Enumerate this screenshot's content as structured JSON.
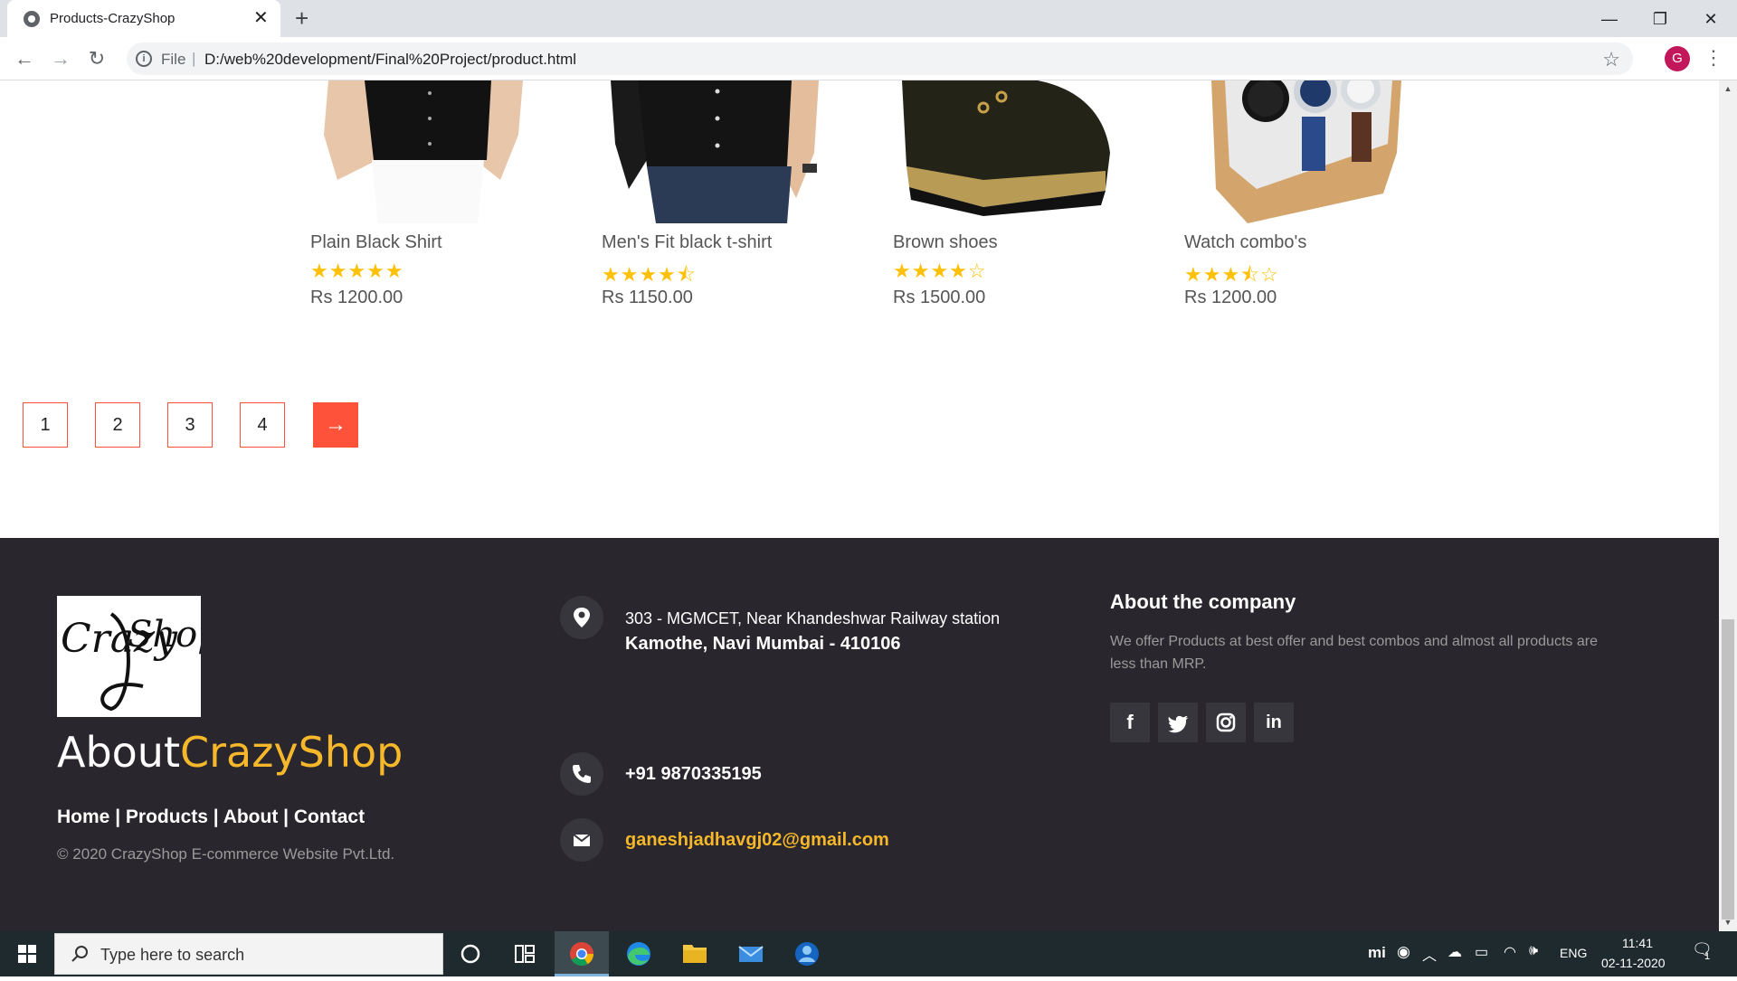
{
  "browser": {
    "tab_title": "Products-CrazyShop",
    "url_scheme": "File",
    "url": "D:/web%20development/Final%20Project/product.html",
    "profile_initial": "G"
  },
  "products": [
    {
      "name": "Plain Black Shirt",
      "rating": 5,
      "rating_text": "★★★★★",
      "price": "Rs 1200.00"
    },
    {
      "name": "Men's Fit black t-shirt",
      "rating": 4.5,
      "rating_text": "★★★★⯪",
      "price": "Rs 1150.00"
    },
    {
      "name": "Brown shoes",
      "rating": 4,
      "rating_text": "★★★★☆",
      "price": "Rs 1500.00"
    },
    {
      "name": "Watch combo's",
      "rating": 3.5,
      "rating_text": "★★★⯪☆",
      "price": "Rs 1200.00"
    }
  ],
  "pagination": {
    "pages": [
      "1",
      "2",
      "3",
      "4"
    ],
    "next": "→"
  },
  "footer": {
    "brand_about": "About",
    "brand_name": "CrazyShop",
    "links": [
      "Home",
      "Products",
      "About",
      "Contact"
    ],
    "separator": " | ",
    "copyright": "© 2020 CrazyShop E-commerce Website Pvt.Ltd.",
    "address_line1": "303 - MGMCET, Near Khandeshwar Railway station",
    "address_line2": "Kamothe, Navi Mumbai - 410106",
    "phone": "+91 9870335195",
    "email": "ganeshjadhavgj02@gmail.com",
    "about_title": "About the company",
    "about_text": "We offer Products at best offer and best combos and almost all products are less than MRP.",
    "social": [
      "facebook-icon",
      "twitter-icon",
      "instagram-icon",
      "linkedin-icon"
    ],
    "accent_color": "#f6b82a",
    "bg_color": "#29272d"
  },
  "taskbar": {
    "search_placeholder": "Type here to search",
    "tray_lang": "ENG",
    "tray_brand": "mi",
    "time": "11:41",
    "date": "02-11-2020",
    "notification_count": "1"
  },
  "colors": {
    "accent": "#ff523b",
    "star": "#ffc107"
  }
}
